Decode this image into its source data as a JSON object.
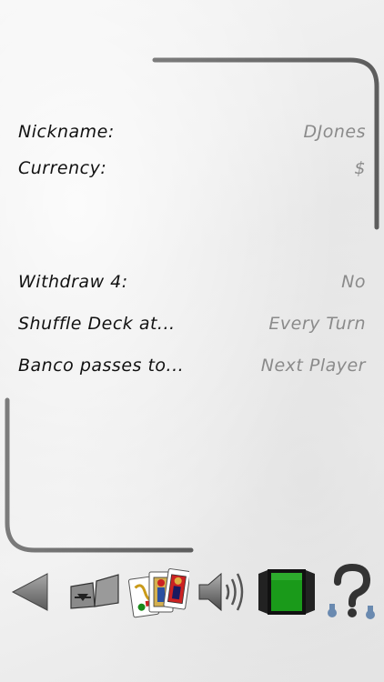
{
  "settings": {
    "nickname": {
      "label": "Nickname:",
      "value": "DJones"
    },
    "currency": {
      "label": "Currency:",
      "value": "$"
    },
    "withdraw": {
      "label": "Withdraw 4:",
      "value": "No"
    },
    "shuffle": {
      "label": "Shuffle Deck at...",
      "value": "Every Turn"
    },
    "banco": {
      "label": "Banco passes to...",
      "value": "Next Player"
    }
  },
  "toolbar": {
    "icons": [
      "back-arrow-icon",
      "open-book-icon",
      "playing-cards-icon",
      "speaker-sound-icon",
      "green-square-icon",
      "help-question-icon"
    ]
  },
  "colors": {
    "accent_green": "#1a9a1a",
    "label": "#111111",
    "value": "#8a8a8a"
  }
}
